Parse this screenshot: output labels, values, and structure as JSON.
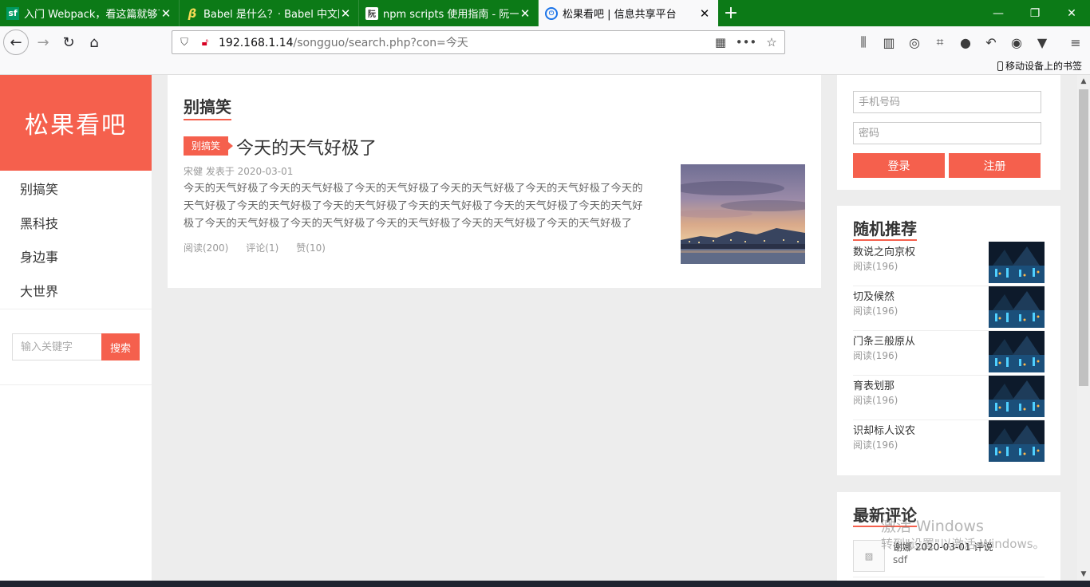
{
  "tabs": [
    {
      "title": "入门 Webpack，看这篇就够了",
      "icon": "sf-icon"
    },
    {
      "title": "Babel 是什么？· Babel 中文网",
      "icon": "babel-icon"
    },
    {
      "title": "npm scripts 使用指南 - 阮一峰",
      "icon": "npm-icon"
    },
    {
      "title": "松果看吧 | 信息共享平台",
      "icon": "power-icon",
      "active": true
    }
  ],
  "address": {
    "host": "192.168.1.14",
    "path": "/songguo/search.php?con=今天"
  },
  "bookmarks": {
    "mobile": "移动设备上的书签"
  },
  "site": {
    "logo": "松果看吧",
    "nav": [
      "别搞笑",
      "黑科技",
      "身边事",
      "大世界"
    ],
    "search": {
      "placeholder": "输入关键字",
      "button": "搜索"
    }
  },
  "main": {
    "section_title": "别搞笑",
    "post": {
      "category": "别搞笑",
      "title": "今天的天气好极了",
      "meta": "宋健 发表于 2020-03-01",
      "excerpt": "今天的天气好极了今天的天气好极了今天的天气好极了今天的天气好极了今天的天气好极了今天的天气好极了今天的天气好极了今天的天气好极了今天的天气好极了今天的天气好极了今天的天气好极了今天的天气好极了今天的天气好极了今天的天气好极了今天的天气好极了今天的天气好极了",
      "views": "阅读(200)",
      "comments": "评论(1)",
      "likes": "赞(10)"
    }
  },
  "login": {
    "phone_placeholder": "手机号码",
    "password_placeholder": "密码",
    "login_button": "登录",
    "register_button": "注册"
  },
  "recommend": {
    "title": "随机推荐",
    "items": [
      {
        "title": "数说之向京权",
        "views": "阅读(196)"
      },
      {
        "title": "切及候然",
        "views": "阅读(196)"
      },
      {
        "title": "门条三般原从",
        "views": "阅读(196)"
      },
      {
        "title": "育表划那",
        "views": "阅读(196)"
      },
      {
        "title": "识却标人议农",
        "views": "阅读(196)"
      }
    ]
  },
  "comments": {
    "title": "最新评论",
    "latest": {
      "meta": "谢娜 2020-03-01 评说",
      "text": "sdf"
    }
  },
  "watermark": {
    "line1": "激活 Windows",
    "line2": "转到\"设置\"以激活 Windows。"
  },
  "colors": {
    "accent": "#f5604d",
    "tabbar": "#0c7a17"
  }
}
